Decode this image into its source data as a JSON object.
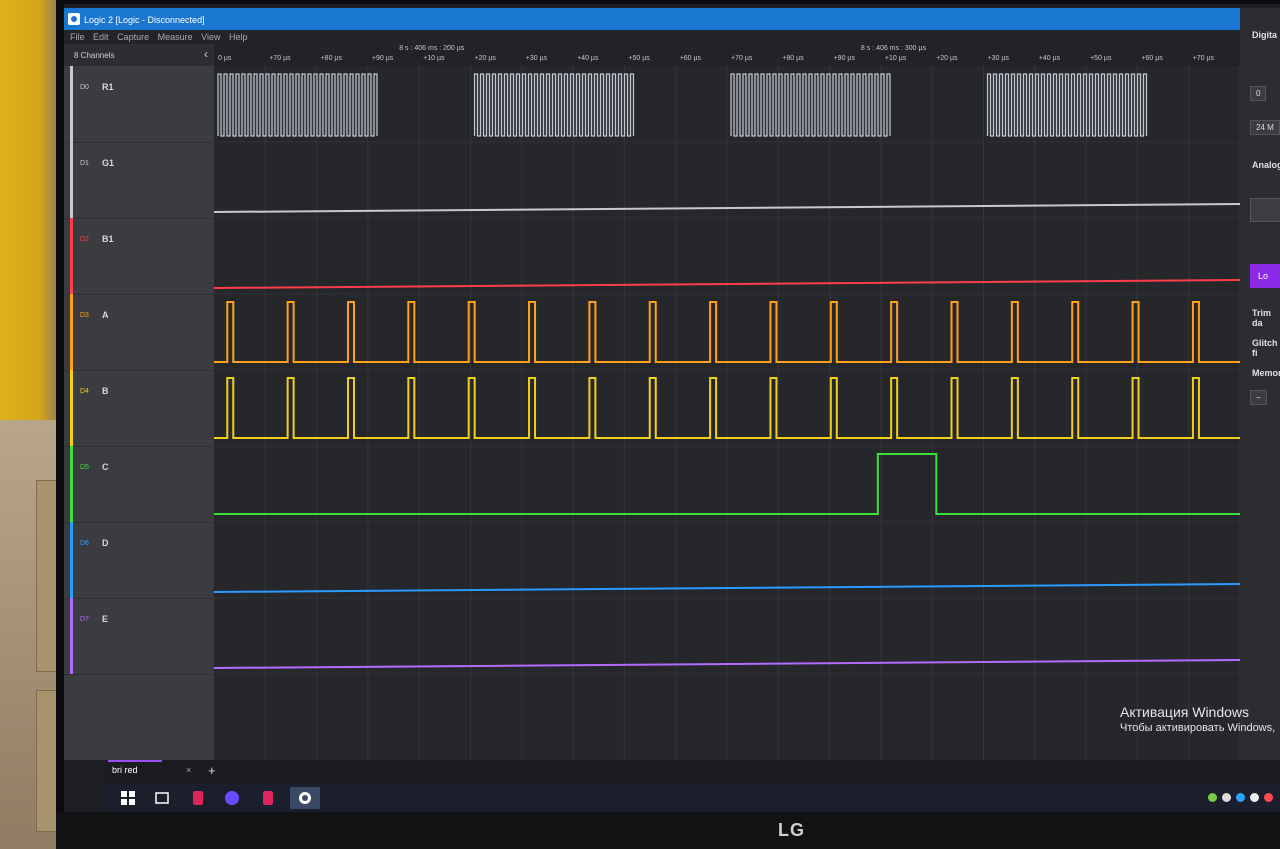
{
  "window": {
    "title": "Logic 2 [Logic - Disconnected]"
  },
  "menu": [
    "File",
    "Edit",
    "Capture",
    "Measure",
    "View",
    "Help"
  ],
  "channels_panel": {
    "header": "8 Channels",
    "collapse_glyph": "‹",
    "channels": [
      {
        "id": "D0",
        "name": "R1",
        "color": "#c9c9c9"
      },
      {
        "id": "D1",
        "name": "G1",
        "color": "#c9c9c9"
      },
      {
        "id": "D2",
        "name": "B1",
        "color": "#ff3d4a"
      },
      {
        "id": "D3",
        "name": "A",
        "color": "#ffa21a"
      },
      {
        "id": "D4",
        "name": "B",
        "color": "#f2cf1a"
      },
      {
        "id": "D5",
        "name": "C",
        "color": "#3be03b"
      },
      {
        "id": "D6",
        "name": "D",
        "color": "#2b9bff"
      },
      {
        "id": "D7",
        "name": "E",
        "color": "#b36bff"
      }
    ]
  },
  "timeline": {
    "ticks": [
      "0 µs",
      "+70 µs",
      "+80 µs",
      "+90 µs",
      "+10 µs",
      "+20 µs",
      "+30 µs",
      "+40 µs",
      "+50 µs",
      "+60 µs",
      "+70 µs",
      "+80 µs",
      "+90 µs",
      "+10 µs",
      "+20 µs",
      "+30 µs",
      "+40 µs",
      "+50 µs",
      "+60 µs",
      "+70 µs"
    ],
    "markers": [
      "8 s : 406 ms : 200 µs",
      "8 s : 406 ms : 300 µs"
    ]
  },
  "signal_data": {
    "D0_bursts": 4,
    "D3_pulses": 17,
    "D4_pulses": 17,
    "D5_high_segments": 1
  },
  "right_panel": {
    "digital_label": "Digita",
    "digital_value": "0",
    "rate_value": "24 M",
    "analog_label": "Analog",
    "purple_button": "Lo",
    "trim_label": "Trim da",
    "glitch_label": "Glitch fi",
    "memory_label": "Memor",
    "memory_minus": "−"
  },
  "tabs": [
    {
      "label": "bri red",
      "close": "×"
    }
  ],
  "tab_add": "+",
  "activation": {
    "line1": "Активация Windows",
    "line2": "Чтобы активировать Windows,"
  },
  "monitor_brand": "LG"
}
